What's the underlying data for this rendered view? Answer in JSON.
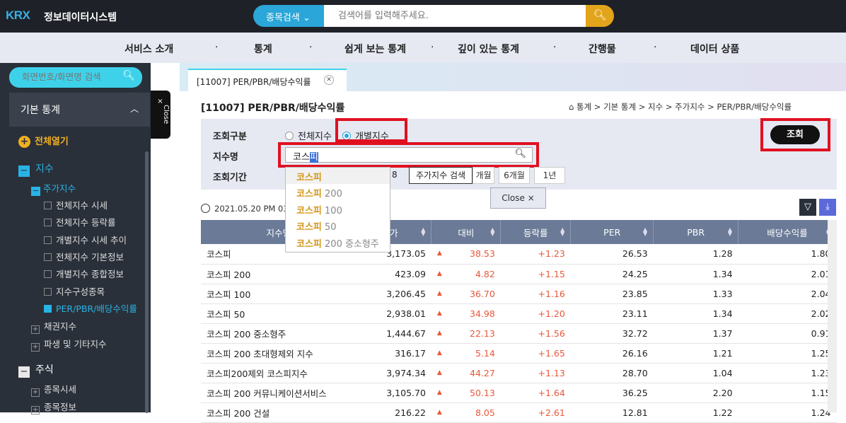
{
  "header": {
    "logo": "KRX",
    "site_title": "정보데이터시스템",
    "search_category": "종목검색",
    "search_placeholder": "검색어를 입력해주세요."
  },
  "gnb": [
    "서비스 소개",
    "통계",
    "쉽게 보는 통계",
    "깊이 있는 통계",
    "간행물",
    "데이터 상품"
  ],
  "sidebar": {
    "search_placeholder": "화면번호/화면명 검색",
    "section_title": "기본 통계",
    "expand_all": "전체열기",
    "close_label": "Close",
    "items": [
      {
        "label": "지수",
        "level": 1
      },
      {
        "label": "주가지수",
        "level": 2
      },
      {
        "label": "전체지수 시세",
        "level": 3
      },
      {
        "label": "전체지수 등락률",
        "level": 3
      },
      {
        "label": "개별지수 시세 추이",
        "level": 3
      },
      {
        "label": "전체지수 기본정보",
        "level": 3
      },
      {
        "label": "개별지수 종합정보",
        "level": 3
      },
      {
        "label": "지수구성종목",
        "level": 3
      },
      {
        "label": "PER/PBR/배당수익률",
        "level": 3,
        "active": true
      },
      {
        "label": "채권지수",
        "level": 2
      },
      {
        "label": "파생 및 기타지수",
        "level": 2
      },
      {
        "label": "주식",
        "level": 1
      },
      {
        "label": "종목시세",
        "level": 2
      },
      {
        "label": "종목정보",
        "level": 2
      }
    ]
  },
  "tab": {
    "label": "[11007] PER/PBR/배당수익률"
  },
  "page": {
    "title": "[11007] PER/PBR/배당수익률",
    "breadcrumb": [
      "통계",
      "기본 통계",
      "지수",
      "주가지수",
      "PER/PBR/배당수익률"
    ]
  },
  "filter": {
    "query_type_label": "조회구분",
    "option_all": "전체지수",
    "option_individual": "개별지수",
    "index_name_label": "지수명",
    "index_name_typed": "코스",
    "index_name_composing": "피",
    "period_label": "조회기간",
    "date_fragment": "8",
    "tooltip": "주가지수 검색",
    "period_buttons": [
      "개월",
      "6개월",
      "1년"
    ],
    "query_button": "조회",
    "close_button": "Close"
  },
  "autocomplete": [
    {
      "match": "코스피",
      "rest": ""
    },
    {
      "match": "코스피",
      "rest": " 200"
    },
    {
      "match": "코스피",
      "rest": " 100"
    },
    {
      "match": "코스피",
      "rest": " 50"
    },
    {
      "match": "코스피",
      "rest": " 200 중소형주"
    }
  ],
  "timestamp": "2021.05.20 PM 03:",
  "table": {
    "columns": [
      "지수명",
      "가",
      "대비",
      "등락률",
      "PER",
      "PBR",
      "배당수익률"
    ],
    "rows": [
      {
        "name": "코스피",
        "close": "3,173.05",
        "change": "38.53",
        "rate": "+1.23",
        "per": "26.53",
        "pbr": "1.28",
        "div": "1.80"
      },
      {
        "name": "코스피 200",
        "close": "423.09",
        "change": "4.82",
        "rate": "+1.15",
        "per": "24.25",
        "pbr": "1.34",
        "div": "2.01"
      },
      {
        "name": "코스피 100",
        "close": "3,206.45",
        "change": "36.70",
        "rate": "+1.16",
        "per": "23.85",
        "pbr": "1.33",
        "div": "2.04"
      },
      {
        "name": "코스피 50",
        "close": "2,938.01",
        "change": "34.98",
        "rate": "+1.20",
        "per": "23.11",
        "pbr": "1.34",
        "div": "2.02"
      },
      {
        "name": "코스피 200 중소형주",
        "close": "1,444.67",
        "change": "22.13",
        "rate": "+1.56",
        "per": "32.72",
        "pbr": "1.37",
        "div": "0.91"
      },
      {
        "name": "코스피 200 초대형제외 지수",
        "close": "316.17",
        "change": "5.14",
        "rate": "+1.65",
        "per": "26.16",
        "pbr": "1.21",
        "div": "1.25"
      },
      {
        "name": "코스피200제외 코스피지수",
        "close": "3,974.34",
        "change": "44.27",
        "rate": "+1.13",
        "per": "28.70",
        "pbr": "1.04",
        "div": "1.23"
      },
      {
        "name": "코스피 200 커뮤니케이션서비스",
        "close": "3,105.70",
        "change": "50.13",
        "rate": "+1.64",
        "per": "36.25",
        "pbr": "2.20",
        "div": "1.15"
      },
      {
        "name": "코스피 200 건설",
        "close": "216.22",
        "change": "8.05",
        "rate": "+2.61",
        "per": "12.81",
        "pbr": "1.22",
        "div": "1.24"
      }
    ]
  },
  "colors": {
    "accent": "#2aa6d8",
    "up": "#e8583a",
    "header_bg": "#6a7a97",
    "highlight": "#e01020"
  }
}
